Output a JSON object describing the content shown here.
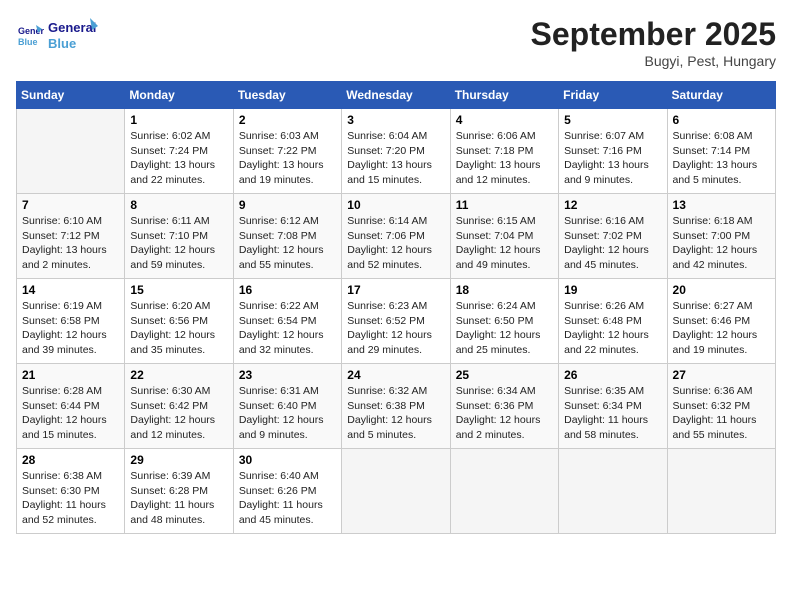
{
  "header": {
    "logo_line1": "General",
    "logo_line2": "Blue",
    "month": "September 2025",
    "location": "Bugyi, Pest, Hungary"
  },
  "weekdays": [
    "Sunday",
    "Monday",
    "Tuesday",
    "Wednesday",
    "Thursday",
    "Friday",
    "Saturday"
  ],
  "weeks": [
    [
      {
        "day": "",
        "text": ""
      },
      {
        "day": "1",
        "text": "Sunrise: 6:02 AM\nSunset: 7:24 PM\nDaylight: 13 hours\nand 22 minutes."
      },
      {
        "day": "2",
        "text": "Sunrise: 6:03 AM\nSunset: 7:22 PM\nDaylight: 13 hours\nand 19 minutes."
      },
      {
        "day": "3",
        "text": "Sunrise: 6:04 AM\nSunset: 7:20 PM\nDaylight: 13 hours\nand 15 minutes."
      },
      {
        "day": "4",
        "text": "Sunrise: 6:06 AM\nSunset: 7:18 PM\nDaylight: 13 hours\nand 12 minutes."
      },
      {
        "day": "5",
        "text": "Sunrise: 6:07 AM\nSunset: 7:16 PM\nDaylight: 13 hours\nand 9 minutes."
      },
      {
        "day": "6",
        "text": "Sunrise: 6:08 AM\nSunset: 7:14 PM\nDaylight: 13 hours\nand 5 minutes."
      }
    ],
    [
      {
        "day": "7",
        "text": "Sunrise: 6:10 AM\nSunset: 7:12 PM\nDaylight: 13 hours\nand 2 minutes."
      },
      {
        "day": "8",
        "text": "Sunrise: 6:11 AM\nSunset: 7:10 PM\nDaylight: 12 hours\nand 59 minutes."
      },
      {
        "day": "9",
        "text": "Sunrise: 6:12 AM\nSunset: 7:08 PM\nDaylight: 12 hours\nand 55 minutes."
      },
      {
        "day": "10",
        "text": "Sunrise: 6:14 AM\nSunset: 7:06 PM\nDaylight: 12 hours\nand 52 minutes."
      },
      {
        "day": "11",
        "text": "Sunrise: 6:15 AM\nSunset: 7:04 PM\nDaylight: 12 hours\nand 49 minutes."
      },
      {
        "day": "12",
        "text": "Sunrise: 6:16 AM\nSunset: 7:02 PM\nDaylight: 12 hours\nand 45 minutes."
      },
      {
        "day": "13",
        "text": "Sunrise: 6:18 AM\nSunset: 7:00 PM\nDaylight: 12 hours\nand 42 minutes."
      }
    ],
    [
      {
        "day": "14",
        "text": "Sunrise: 6:19 AM\nSunset: 6:58 PM\nDaylight: 12 hours\nand 39 minutes."
      },
      {
        "day": "15",
        "text": "Sunrise: 6:20 AM\nSunset: 6:56 PM\nDaylight: 12 hours\nand 35 minutes."
      },
      {
        "day": "16",
        "text": "Sunrise: 6:22 AM\nSunset: 6:54 PM\nDaylight: 12 hours\nand 32 minutes."
      },
      {
        "day": "17",
        "text": "Sunrise: 6:23 AM\nSunset: 6:52 PM\nDaylight: 12 hours\nand 29 minutes."
      },
      {
        "day": "18",
        "text": "Sunrise: 6:24 AM\nSunset: 6:50 PM\nDaylight: 12 hours\nand 25 minutes."
      },
      {
        "day": "19",
        "text": "Sunrise: 6:26 AM\nSunset: 6:48 PM\nDaylight: 12 hours\nand 22 minutes."
      },
      {
        "day": "20",
        "text": "Sunrise: 6:27 AM\nSunset: 6:46 PM\nDaylight: 12 hours\nand 19 minutes."
      }
    ],
    [
      {
        "day": "21",
        "text": "Sunrise: 6:28 AM\nSunset: 6:44 PM\nDaylight: 12 hours\nand 15 minutes."
      },
      {
        "day": "22",
        "text": "Sunrise: 6:30 AM\nSunset: 6:42 PM\nDaylight: 12 hours\nand 12 minutes."
      },
      {
        "day": "23",
        "text": "Sunrise: 6:31 AM\nSunset: 6:40 PM\nDaylight: 12 hours\nand 9 minutes."
      },
      {
        "day": "24",
        "text": "Sunrise: 6:32 AM\nSunset: 6:38 PM\nDaylight: 12 hours\nand 5 minutes."
      },
      {
        "day": "25",
        "text": "Sunrise: 6:34 AM\nSunset: 6:36 PM\nDaylight: 12 hours\nand 2 minutes."
      },
      {
        "day": "26",
        "text": "Sunrise: 6:35 AM\nSunset: 6:34 PM\nDaylight: 11 hours\nand 58 minutes."
      },
      {
        "day": "27",
        "text": "Sunrise: 6:36 AM\nSunset: 6:32 PM\nDaylight: 11 hours\nand 55 minutes."
      }
    ],
    [
      {
        "day": "28",
        "text": "Sunrise: 6:38 AM\nSunset: 6:30 PM\nDaylight: 11 hours\nand 52 minutes."
      },
      {
        "day": "29",
        "text": "Sunrise: 6:39 AM\nSunset: 6:28 PM\nDaylight: 11 hours\nand 48 minutes."
      },
      {
        "day": "30",
        "text": "Sunrise: 6:40 AM\nSunset: 6:26 PM\nDaylight: 11 hours\nand 45 minutes."
      },
      {
        "day": "",
        "text": ""
      },
      {
        "day": "",
        "text": ""
      },
      {
        "day": "",
        "text": ""
      },
      {
        "day": "",
        "text": ""
      }
    ]
  ]
}
